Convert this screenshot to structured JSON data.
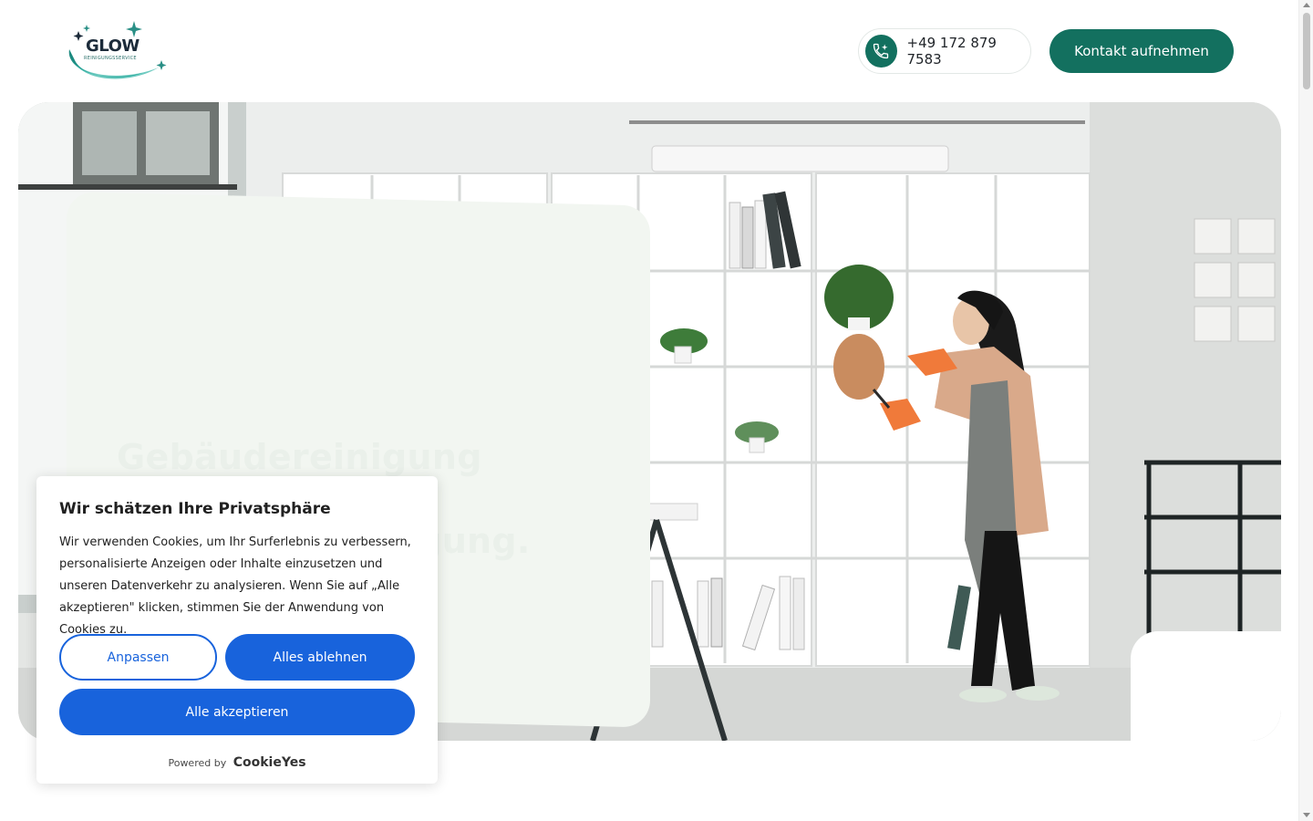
{
  "header": {
    "logo": {
      "name": "GLOW",
      "tagline": "REINIGUNGSSERVICE"
    },
    "phone": {
      "number": "+49 172 879 7583",
      "icon": "phone-icon"
    },
    "contact_button": "Kontakt aufnehmen"
  },
  "hero": {
    "heading_line1": "Gebäudereinigung München",
    "heading_line2": "Unterhaltsreinigung.",
    "card_color": "#f2f6f1"
  },
  "cookie_banner": {
    "title": "Wir schätzen Ihre Privatsphäre",
    "body": "Wir verwenden Cookies, um Ihr Surferlebnis zu verbessern, personalisierte Anzeigen oder Inhalte einzusetzen und unseren Datenverkehr zu analysieren. Wenn Sie auf „Alle akzeptieren\" klicken, stimmen Sie der Anwendung von Cookies zu.",
    "customize_label": "Anpassen",
    "reject_label": "Alles ablehnen",
    "accept_label": "Alle akzeptieren",
    "powered_by": "Powered by",
    "brand": "CookieYes"
  },
  "colors": {
    "brand_teal": "#13705f",
    "cookie_blue": "#1863dc"
  }
}
